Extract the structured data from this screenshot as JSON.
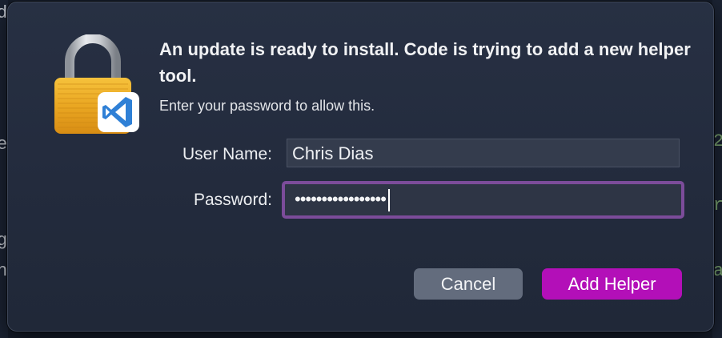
{
  "dialog": {
    "title": "An update is ready to install. Code is trying to add a new helper tool.",
    "subtitle": "Enter your password to allow this.",
    "user_label": "User Name:",
    "user_value": "Chris Dias",
    "password_label": "Password:",
    "password_masked": "•••••••••••••••••",
    "cancel_label": "Cancel",
    "confirm_label": "Add Helper",
    "icon": "lock-with-vscode-badge-icon"
  },
  "background": {
    "glyphs": [
      "d",
      "e",
      "g",
      "n",
      "2",
      "r",
      "a"
    ]
  },
  "colors": {
    "accent": "#b30fb8",
    "focus_ring": "#7c4c9a",
    "cancel_button": "#636c7d"
  }
}
